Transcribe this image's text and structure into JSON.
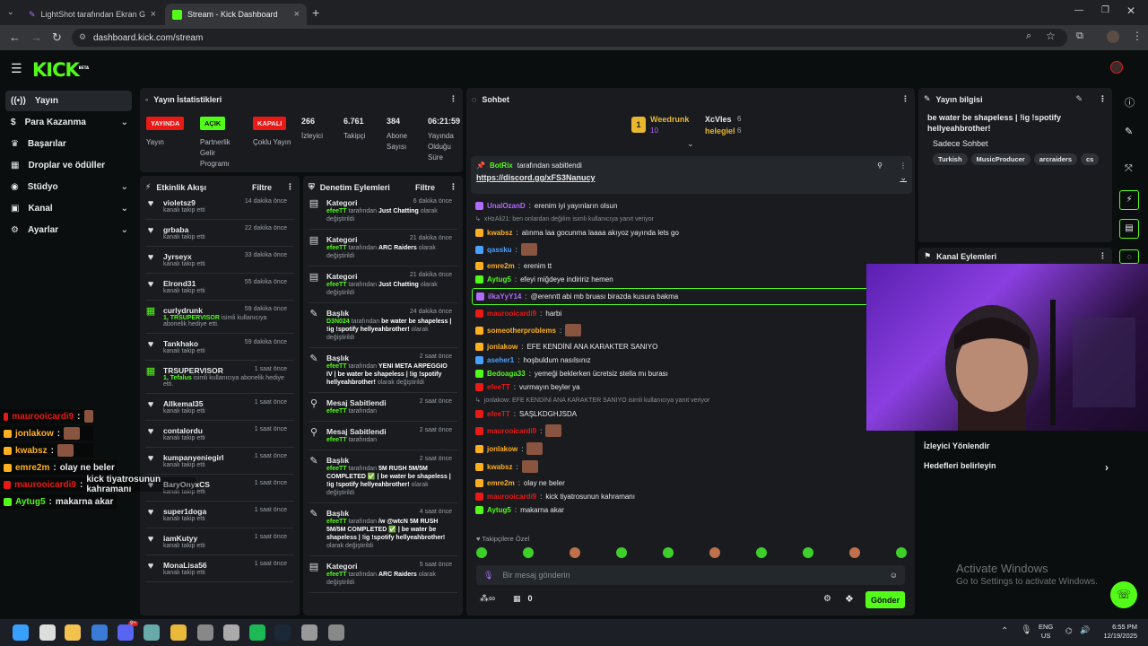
{
  "browser": {
    "tabs": [
      {
        "label": "LightShot tarafından Ekran Görü"
      },
      {
        "label": "Stream - Kick Dashboard"
      }
    ],
    "url": "dashboard.kick.com/stream"
  },
  "app": {
    "logo": "KICK",
    "logo_sup": "BETA"
  },
  "sidebar": {
    "items": [
      {
        "label": "Yayın",
        "icon": "broadcast-icon"
      },
      {
        "label": "Para Kazanma",
        "icon": "money-icon"
      },
      {
        "label": "Başarılar",
        "icon": "trophy-icon"
      },
      {
        "label": "Droplar ve ödüller",
        "icon": "gift-icon"
      },
      {
        "label": "Stüdyo",
        "icon": "studio-icon"
      },
      {
        "label": "Kanal",
        "icon": "channel-icon"
      },
      {
        "label": "Ayarlar",
        "icon": "gear-icon"
      }
    ]
  },
  "stats": {
    "title": "Yayın İstatistikleri",
    "badges": [
      {
        "text": "YAYINDA",
        "label": "Yayın",
        "color": "#e91916"
      },
      {
        "text": "AÇIK",
        "label": "Partnerlik Gelir Programı",
        "color": "#53fc18"
      },
      {
        "text": "KAPALI",
        "label": "Çoklu Yayın",
        "color": "#e91916"
      }
    ],
    "numbers": [
      {
        "value": "266",
        "label": "İzleyici"
      },
      {
        "value": "6.761",
        "label": "Takipçi"
      },
      {
        "value": "384",
        "label": "Abone Sayısı"
      },
      {
        "value": "06:21:59",
        "label": "Yayında Olduğu Süre"
      }
    ]
  },
  "activity": {
    "title": "Etkinlik Akışı",
    "filter": "Filtre",
    "items": [
      {
        "name": "violetsz9",
        "sub": "kanalı takip etti",
        "time": "14 dakika önce"
      },
      {
        "name": "grbaba",
        "sub": "kanalı takip etti",
        "time": "22 dakika önce"
      },
      {
        "name": "Jyrseyx",
        "sub": "kanalı takip etti",
        "time": "33 dakika önce"
      },
      {
        "name": "Elrond31",
        "sub": "kanalı takip etti",
        "time": "55 dakika önce"
      },
      {
        "name": "curlydrunk",
        "sub_green": "1, TRSUPERVISOR",
        "sub": "isimli kullanıcıya abonelik hediye etti.",
        "time": "59 dakika önce"
      },
      {
        "name": "Tankhako",
        "sub": "kanalı takip etti",
        "time": "59 dakika önce"
      },
      {
        "name": "TRSUPERVISOR",
        "sub_green": "1, Tefalus",
        "sub": "isimli kullanıcıya abonelik hediye etti.",
        "time": "1 saat önce"
      },
      {
        "name": "Allkemal35",
        "sub": "kanalı takip etti",
        "time": "1 saat önce"
      },
      {
        "name": "contalordu",
        "sub": "kanalı takip etti",
        "time": "1 saat önce"
      },
      {
        "name": "kumpanyeniegirl",
        "sub": "kanalı takip etti",
        "time": "1 saat önce"
      },
      {
        "name": "BaryOnyxCS",
        "sub": "kanalı takip etti",
        "time": "1 saat önce"
      },
      {
        "name": "super1doga",
        "sub": "kanalı takip etti",
        "time": "1 saat önce"
      },
      {
        "name": "iamKutyy",
        "sub": "kanalı takip etti",
        "time": "1 saat önce"
      },
      {
        "name": "MonaLisa56",
        "sub": "kanalı takip etti",
        "time": "1 saat önce"
      }
    ]
  },
  "mod": {
    "title": "Denetim Eylemleri",
    "filter": "Filtre",
    "items": [
      {
        "name": "Kategori",
        "who": "efeeTT",
        "mid": "tarafından",
        "hl": "Just Chatting",
        "tail": "olarak değiştirildi",
        "time": "6 dakika önce"
      },
      {
        "name": "Kategori",
        "who": "efeeTT",
        "mid": "tarafından",
        "hl": "ARC Raiders",
        "tail": "olarak değiştirildi",
        "time": "21 dakika önce"
      },
      {
        "name": "Kategori",
        "who": "efeeTT",
        "mid": "tarafından",
        "hl": "Just Chatting",
        "tail": "olarak değiştirildi",
        "time": "21 dakika önce"
      },
      {
        "name": "Başlık",
        "who": "D3N024",
        "mid": "tarafından",
        "hl": "be water be shapeless | !ig !spotify hellyeahbrother!",
        "tail": "olarak değiştirildi",
        "time": "24 dakika önce"
      },
      {
        "name": "Başlık",
        "who": "efeeTT",
        "mid": "tarafından",
        "hl": "YENI META ARPEGGIO IV | be water be shapeless | !ig !spotify hellyeahbrother!",
        "tail": "olarak değiştirildi",
        "time": "2 saat önce"
      },
      {
        "name": "Mesaj Sabitlendi",
        "who": "efeeTT",
        "mid": "tarafından",
        "hl": "",
        "tail": "",
        "time": "2 saat önce"
      },
      {
        "name": "Mesaj Sabitlendi",
        "who": "efeeTT",
        "mid": "tarafından",
        "hl": "",
        "tail": "",
        "time": "2 saat önce"
      },
      {
        "name": "Başlık",
        "who": "efeeTT",
        "mid": "tarafından",
        "hl": "5M RUSH 5M/5M COMPLETED ✅ | be water be shapeless | !ig !spotify hellyeahbrother!",
        "tail": "olarak değiştirildi",
        "time": "2 saat önce"
      },
      {
        "name": "Başlık",
        "who": "efeeTT",
        "mid": "tarafından",
        "hl": "/w @wtcN 5M RUSH 5M/5M COMPLETED ✅ | be water be shapeless | !ig !spotify hellyeahbrother!",
        "tail": "olarak değiştirildi",
        "time": "4 saat önce"
      },
      {
        "name": "Kategori",
        "who": "efeeTT",
        "mid": "tarafından",
        "hl": "ARC Raiders",
        "tail": "olarak değiştirildi",
        "time": "5 saat önce"
      }
    ]
  },
  "chat": {
    "title": "Sohbet",
    "top": [
      {
        "name": "Weedrunk",
        "count": "10"
      },
      {
        "name": "XcVles",
        "count": "6"
      },
      {
        "name": "helegiel",
        "count": "6"
      }
    ],
    "pinned_by": "BotRix",
    "pinned_suffix": "tarafından sabitlendi",
    "pinned_link": "https://discord.gg/xFS3Nanucy",
    "messages": [
      {
        "user": "UnalOzanD",
        "color": "#b36bff",
        "text": "erenim iyi yayınların olsun"
      },
      {
        "reply": "xHzAli21: ben onlardan değilim isimli kullanıcıya yanıt veriyor"
      },
      {
        "user": "kwabsz",
        "color": "#ffb020",
        "text": "alınma laa gocunma laaaa akıyoz yayında lets go"
      },
      {
        "user": "qassku",
        "color": "#4aa0ff",
        "text": ""
      },
      {
        "user": "emre2m",
        "color": "#ffb020",
        "text": "erenim tt"
      },
      {
        "user": "Aytug5",
        "color": "#53fc18",
        "text": "efeyi miğdeye indiririz hemen"
      },
      {
        "user": "ilkaYyY14",
        "color": "#b36bff",
        "text": "@erenntt abi mb bruası birazda kusura bakma"
      },
      {
        "user": "maurooicardi9",
        "color": "#e91916",
        "text": "harbi"
      },
      {
        "user": "someotherproblems",
        "color": "#ffb020",
        "text": ""
      },
      {
        "user": "jonlakow",
        "color": "#ffb020",
        "text": "EFE KENDİNİ ANA KARAKTER SANIYO"
      },
      {
        "user": "aseher1",
        "color": "#4aa0ff",
        "text": "hoşbuldum nasılsınız"
      },
      {
        "user": "Bedoaga33",
        "color": "#53fc18",
        "text": "yemeği beklerken ücretsiz stella mı burası"
      },
      {
        "user": "efeeTT",
        "color": "#e91916",
        "text": "vurmayın beyler ya"
      },
      {
        "reply": "jonlakow: EFE KENDİNİ ANA KARAKTER SANIYO isimli kullanıcıya yanıt veriyor"
      },
      {
        "user": "efeeTT",
        "color": "#e91916",
        "text": "SAŞLKDGHJSDA"
      },
      {
        "user": "maurooicardi9",
        "color": "#e91916",
        "text": ""
      },
      {
        "user": "jonlakow",
        "color": "#ffb020",
        "text": ""
      },
      {
        "user": "kwabsz",
        "color": "#ffb020",
        "text": ""
      },
      {
        "user": "emre2m",
        "color": "#ffb020",
        "text": "olay ne beler"
      },
      {
        "user": "maurooicardi9",
        "color": "#e91916",
        "text": "kick tiyatrosunun kahramanı"
      },
      {
        "user": "Aytug5",
        "color": "#53fc18",
        "text": "makarna akar"
      }
    ],
    "followers_only": "Takipçilere Özel",
    "placeholder": "Bir mesaj gönderin",
    "points": "0",
    "send": "Gönder"
  },
  "info": {
    "title": "Yayın bilgisi",
    "stream_title": "be water be shapeless | !ig !spotify hellyeahbrother!",
    "category": "Sadece Sohbet",
    "tags": [
      "Turkish",
      "MusicProducer",
      "arcraiders",
      "cs"
    ]
  },
  "actions": {
    "title": "Kanal Eylemleri"
  },
  "raid": {
    "title": "İzleyici Yönlendir",
    "link": "Hedefleri belirleyin"
  },
  "watermark": {
    "title": "Activate Windows",
    "sub": "Go to Settings to activate Windows."
  },
  "overlay": [
    {
      "user": "maurooicardi9",
      "color": "#e91916",
      "text": ""
    },
    {
      "user": "jonlakow",
      "color": "#ffb020",
      "text": ""
    },
    {
      "user": "kwabsz",
      "color": "#ffb020",
      "text": ""
    },
    {
      "user": "emre2m",
      "color": "#ffb020",
      "text": "olay ne beler"
    },
    {
      "user": "maurooicardi9",
      "color": "#e91916",
      "text": "kick tiyatrosunun kahramanı"
    },
    {
      "user": "Aytug5",
      "color": "#53fc18",
      "text": "makarna akar"
    }
  ],
  "taskbar": {
    "lang": "ENG",
    "region": "US",
    "time": "6:55 PM",
    "date": "12/19/2025",
    "badge": "9+"
  }
}
